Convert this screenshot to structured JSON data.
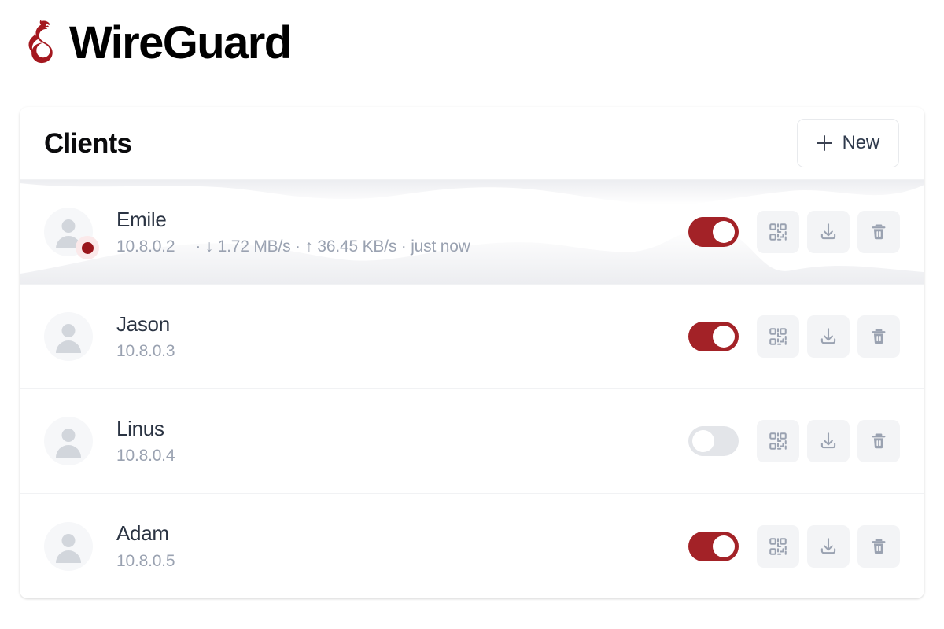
{
  "brand": {
    "title": "WireGuard",
    "logo_icon": "wireguard-dragon-logo",
    "logo_color": "#a4181f"
  },
  "card": {
    "title": "Clients",
    "new_button": {
      "label": "New",
      "icon": "plus-icon"
    }
  },
  "colors": {
    "accent_red": "#a32227",
    "status_dot": "#99151b",
    "status_halo": "#fbe9ea",
    "toggle_off": "#e3e5e9",
    "icon_button_bg": "#f3f4f6",
    "icon_glyph": "#9aa2b1",
    "name_text": "#2b3443",
    "muted_text": "#9aa2b1"
  },
  "actions": {
    "qr_label": "qr-code-icon",
    "download_label": "download-icon",
    "delete_label": "trash-icon",
    "toggle_label": "enable-toggle"
  },
  "clients": [
    {
      "name": "Emile",
      "ip": "10.8.0.2",
      "stats": "· ↓ 1.72 MB/s · ↑ 36.45 KB/s · just now",
      "enabled": true,
      "online": true,
      "active_waves": true,
      "download_rate": "1.72 MB/s",
      "upload_rate": "36.45 KB/s",
      "last_seen": "just now"
    },
    {
      "name": "Jason",
      "ip": "10.8.0.3",
      "stats": "",
      "enabled": true,
      "online": false,
      "active_waves": false
    },
    {
      "name": "Linus",
      "ip": "10.8.0.4",
      "stats": "",
      "enabled": false,
      "online": false,
      "active_waves": false
    },
    {
      "name": "Adam",
      "ip": "10.8.0.5",
      "stats": "",
      "enabled": true,
      "online": false,
      "active_waves": false
    }
  ]
}
